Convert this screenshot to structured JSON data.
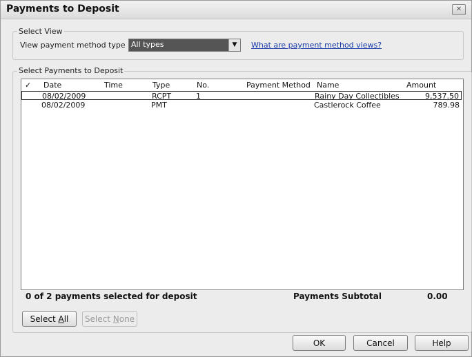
{
  "window": {
    "title": "Payments to Deposit",
    "close_glyph": "✕"
  },
  "select_view": {
    "group_label": "Select View",
    "type_label": "View payment method type",
    "type_value": "All types",
    "help_link": "What are payment method views?"
  },
  "payments": {
    "group_label": "Select Payments to Deposit",
    "columns": {
      "check": "✓",
      "date": "Date",
      "time": "Time",
      "type": "Type",
      "no": "No.",
      "method": "Payment Method",
      "name": "Name",
      "amount": "Amount"
    },
    "rows": [
      {
        "check": "",
        "date": "08/02/2009",
        "time": "",
        "type": "RCPT",
        "no": "1",
        "method": "",
        "name": "Rainy Day Collectibles",
        "amount": "9,537.50"
      },
      {
        "check": "",
        "date": "08/02/2009",
        "time": "",
        "type": "PMT",
        "no": "",
        "method": "",
        "name": "Castlerock Coffee",
        "amount": "789.98"
      }
    ]
  },
  "summary": {
    "selected_text": "0 of 2 payments selected for deposit",
    "subtotal_label": "Payments Subtotal",
    "subtotal_value": "0.00"
  },
  "buttons": {
    "select_all_prefix": "Select ",
    "select_all_key": "A",
    "select_all_suffix": "ll",
    "select_none_prefix": "Select ",
    "select_none_key": "N",
    "select_none_suffix": "one",
    "ok": "OK",
    "cancel": "Cancel",
    "help": "Help"
  }
}
